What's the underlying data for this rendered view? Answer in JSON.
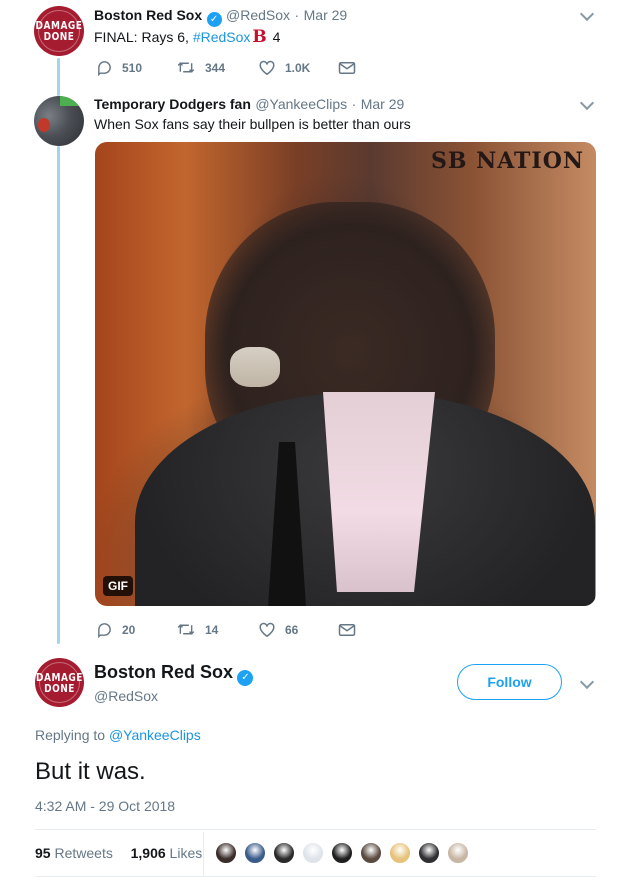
{
  "tweet1": {
    "avatar": {
      "line1": "DAMAGE",
      "line2": "DONE",
      "color": "#a51c30"
    },
    "name": "Boston Red Sox",
    "handle": "@RedSox",
    "date": "Mar 29",
    "text_prefix": "FINAL: Rays 6, ",
    "hashtag": "#RedSox",
    "emoji": "B",
    "text_suffix": " 4",
    "replies": "510",
    "retweets": "344",
    "likes": "1.0K"
  },
  "tweet2": {
    "name": "Temporary Dodgers fan",
    "handle": "@YankeeClips",
    "date": "Mar 29",
    "text": "When Sox fans say their bullpen is better than ours",
    "media": {
      "type": "gif",
      "badge": "GIF",
      "watermark": "SB NATION"
    },
    "replies": "20",
    "retweets": "14",
    "likes": "66"
  },
  "main_tweet": {
    "avatar": {
      "line1": "DAMAGE",
      "line2": "DONE"
    },
    "name": "Boston Red Sox",
    "handle": "@RedSox",
    "follow_label": "Follow",
    "replying_prefix": "Replying to ",
    "replying_handle": "@YankeeClips",
    "text": "But it was.",
    "timestamp": "4:32 AM - 29 Oct 2018",
    "retweets_count": "95",
    "retweets_label": "Retweets",
    "likes_count": "1,906",
    "likes_label": "Likes"
  },
  "likers": [
    {
      "icon": "liker-avatar",
      "color": "#3a2d2a"
    },
    {
      "icon": "liker-avatar",
      "color": "#3b5b8a"
    },
    {
      "icon": "liker-avatar",
      "color": "#2a2a2a"
    },
    {
      "icon": "liker-avatar",
      "color": "#dfe4ea"
    },
    {
      "icon": "liker-avatar",
      "color": "#1f1f1f"
    },
    {
      "icon": "liker-avatar",
      "color": "#5a4a40"
    },
    {
      "icon": "liker-avatar",
      "color": "#e7c27a"
    },
    {
      "icon": "liker-avatar",
      "color": "#2f2f33"
    },
    {
      "icon": "liker-avatar",
      "color": "#c8b6a4"
    }
  ],
  "colors": {
    "accent": "#1da1f2",
    "thread_line": "#9fd6ea",
    "text_secondary": "#657786"
  }
}
